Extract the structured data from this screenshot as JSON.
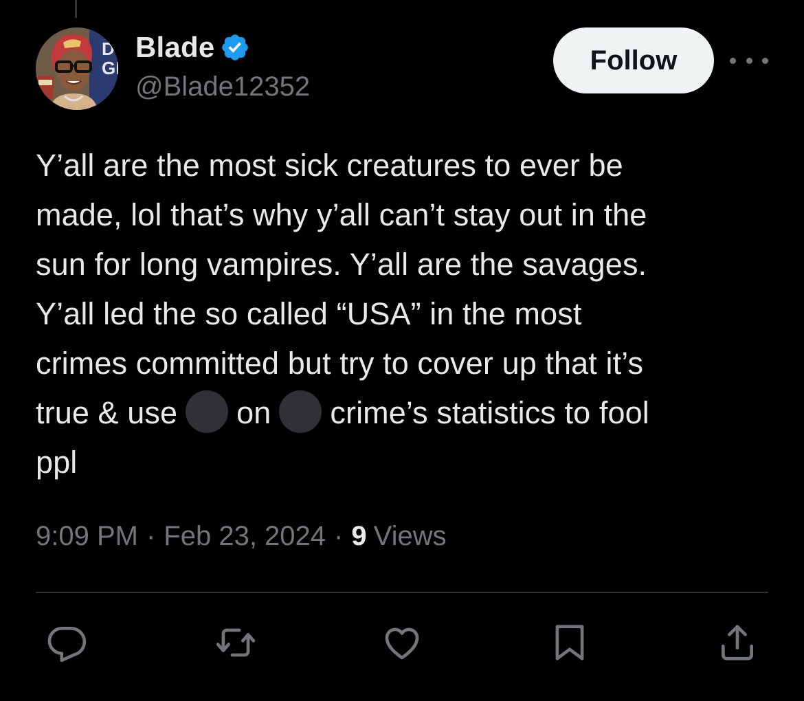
{
  "author": {
    "display_name": "Blade",
    "handle": "@Blade12352",
    "verified": true,
    "verified_color": "#1d9bf0"
  },
  "follow_button": {
    "label": "Follow"
  },
  "more_menu": {
    "icon": "more-horizontal-icon"
  },
  "tweet": {
    "text_lines": [
      "Y’all are the most sick creatures to ever be",
      "made, lol that’s why y’all can’t stay out in the",
      "sun for long vampires. Y’all are the savages.",
      "Y’all led the so called “USA” in the most",
      "crimes committed but try to cover up that it’s"
    ],
    "line6": {
      "part1": "true & use",
      "part2": "on",
      "part3": "crime’s statistics to fool"
    },
    "line7": "ppl"
  },
  "meta": {
    "time": "9:09 PM",
    "separator": "·",
    "date": "Feb 23, 2024",
    "views_count": "9",
    "views_label": "Views"
  },
  "actions": [
    {
      "name": "reply",
      "icon": "reply-icon"
    },
    {
      "name": "retweet",
      "icon": "retweet-icon"
    },
    {
      "name": "like",
      "icon": "heart-icon"
    },
    {
      "name": "bookmark",
      "icon": "bookmark-icon"
    },
    {
      "name": "share",
      "icon": "share-icon"
    }
  ],
  "colors": {
    "background": "#000000",
    "text": "#e7e9ea",
    "secondary_text": "#71767b",
    "divider": "#2f3336",
    "redaction": "#2f3134"
  }
}
